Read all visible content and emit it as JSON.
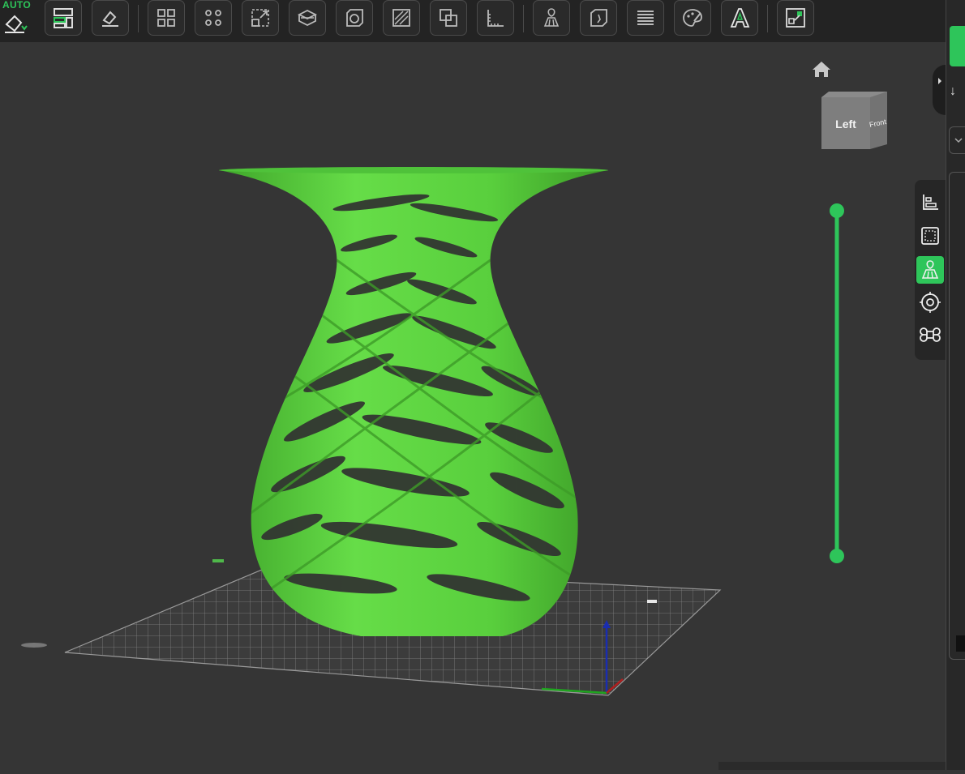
{
  "toolbar": {
    "auto_orient_label": "AUTO",
    "buttons": [
      {
        "name": "auto-orient",
        "icon": "eraser-auto-icon"
      },
      {
        "name": "arrange",
        "icon": "arrange-plates-icon"
      },
      {
        "name": "lay-on-face",
        "icon": "lay-on-face-icon"
      },
      {
        "name": "split-objects",
        "icon": "split-objects-icon"
      },
      {
        "name": "split-parts",
        "icon": "split-parts-icon"
      },
      {
        "name": "scale",
        "icon": "scale-icon"
      },
      {
        "name": "cut",
        "icon": "cut-icon"
      },
      {
        "name": "boolean",
        "icon": "boolean-icon"
      },
      {
        "name": "hollow",
        "icon": "hollow-icon"
      },
      {
        "name": "variable-layer",
        "icon": "variable-layer-icon"
      },
      {
        "name": "measure",
        "icon": "measure-icon"
      },
      {
        "name": "support-paint",
        "icon": "support-paint-icon"
      },
      {
        "name": "seam-paint",
        "icon": "seam-paint-icon"
      },
      {
        "name": "layer-height",
        "icon": "layer-height-icon"
      },
      {
        "name": "color-paint",
        "icon": "color-paint-icon"
      },
      {
        "name": "text",
        "icon": "text-icon"
      },
      {
        "name": "assembly",
        "icon": "assembly-icon"
      }
    ]
  },
  "viewport": {
    "view_cube": {
      "left_face": "Left",
      "front_face": "Front"
    },
    "model_color": "#5bd13c",
    "accent_color": "#2ec55a",
    "layer_slider": {
      "top_value": 1.0,
      "bottom_value": 0.0
    }
  },
  "side_toolbar": [
    {
      "name": "align",
      "icon": "align-icon",
      "active": false
    },
    {
      "name": "select-box",
      "icon": "select-box-icon",
      "active": false
    },
    {
      "name": "support",
      "icon": "support-icon",
      "active": true
    },
    {
      "name": "view-target",
      "icon": "target-icon",
      "active": false
    },
    {
      "name": "clover",
      "icon": "command-icon",
      "active": false
    }
  ]
}
